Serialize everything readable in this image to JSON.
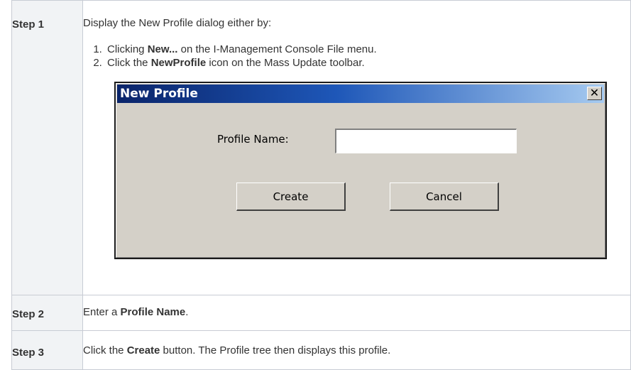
{
  "steps": [
    {
      "label": "Step 1",
      "intro": "Display the New Profile dialog either by:",
      "options": [
        {
          "pre": "Clicking ",
          "bold": "New...",
          "post": " on the I-Management Console File menu."
        },
        {
          "pre": "Click the ",
          "bold": "NewProfile",
          "post": " icon on the Mass Update toolbar."
        }
      ]
    },
    {
      "label": "Step 2",
      "pre": "Enter a ",
      "bold": "Profile Name",
      "post": "."
    },
    {
      "label": "Step 3",
      "pre": "Click the ",
      "bold": "Create",
      "post": " button. The Profile tree then displays this profile."
    }
  ],
  "dialog": {
    "title": "New Profile",
    "close_glyph": "✕",
    "field_label": "Profile Name:",
    "field_value": "",
    "create_label": "Create",
    "cancel_label": "Cancel"
  }
}
